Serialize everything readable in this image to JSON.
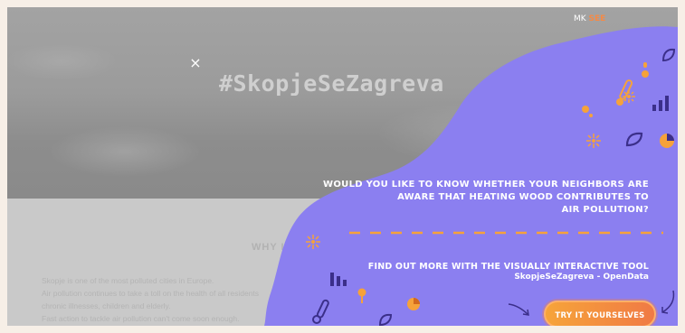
{
  "hero": {
    "title": "#SkopjeSeZagreva",
    "close_label": "×",
    "brand": {
      "part1": "MK",
      "part2": "SEE"
    }
  },
  "content": {
    "heading": "WHY IS S",
    "paragraph_lines": [
      "Skopje is one of the most polluted cities in Europe.",
      "Air pollution continues to take a toll on the health of all residents",
      "chronic illnesses, children and elderly.",
      "Fast action to tackle air pollution can't come soon enough."
    ]
  },
  "popup": {
    "question_lines": [
      "WOULD YOU LIKE TO KNOW WHETHER YOUR NEIGHBORS ARE",
      "AWARE THAT HEATING WOOD CONTRIBUTES TO",
      "AIR POLLUTION?"
    ],
    "find_text": "FIND OUT MORE WITH THE VISUALLY INTERACTIVE TOOL",
    "opendata_text": "SkopjeSeZagreva - OpenData",
    "cta_label": "TRY IT YOURSELVES",
    "colors": {
      "purple": "#8b7ff0",
      "orange": "#f6a23a",
      "accent": "#f07a45"
    },
    "icons": [
      "thermometer-icon",
      "drop-icon",
      "leaf-icon",
      "sun-icon",
      "bar-chart-icon",
      "pie-chart-icon",
      "sparkle-icon",
      "arrow-icon"
    ]
  }
}
